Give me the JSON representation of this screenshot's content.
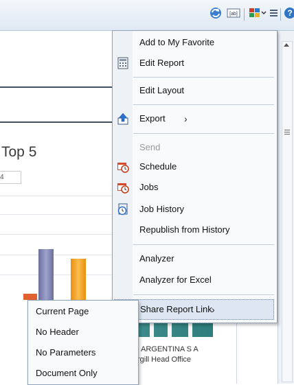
{
  "toolbar": {
    "icons": [
      "refresh-icon",
      "ab-text-icon",
      "grid-view-icon",
      "menu-lines-icon",
      "help-icon"
    ]
  },
  "report": {
    "chart_title": "Top 5",
    "small_box_text": "4",
    "bottom_line1": "ARGENTINA S A",
    "bottom_line2": "rgill Head Office",
    "bar_colors": [
      "#e06030",
      "#7a7fae",
      "#f7a11a",
      "#2e7d7c"
    ]
  },
  "menu": {
    "items": [
      {
        "label": "Add to My Favorite",
        "icon": ""
      },
      {
        "label": "Edit Report",
        "icon": "edit-report-icon"
      },
      {
        "label": "Edit Layout",
        "icon": ""
      },
      {
        "label": "Export",
        "icon": "export-icon",
        "has_submenu": true
      },
      {
        "label": "Send",
        "icon": "",
        "disabled": true
      },
      {
        "label": "Schedule",
        "icon": "schedule-icon"
      },
      {
        "label": "Jobs",
        "icon": "jobs-icon"
      },
      {
        "label": "Job History",
        "icon": "job-history-icon"
      },
      {
        "label": "Republish from History",
        "icon": ""
      },
      {
        "label": "Analyzer",
        "icon": ""
      },
      {
        "label": "Analyzer for Excel",
        "icon": ""
      },
      {
        "label": "Share Report Link",
        "icon": "",
        "has_submenu": true,
        "highlighted": true
      }
    ],
    "submenu_arrow": "›"
  },
  "submenu": {
    "items": [
      "Current Page",
      "No Header",
      "No Parameters",
      "Document Only"
    ]
  }
}
